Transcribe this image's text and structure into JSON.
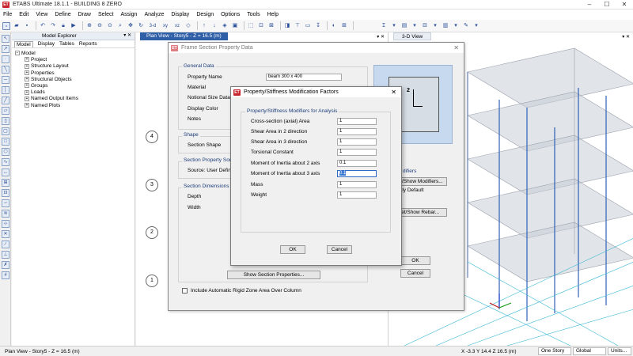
{
  "app": {
    "title": "ETABS Ultimate 18.1.1 - BUILDING 8 ZERO",
    "icon_label": "ET"
  },
  "menu": [
    "File",
    "Edit",
    "View",
    "Define",
    "Draw",
    "Select",
    "Assign",
    "Analyze",
    "Display",
    "Design",
    "Options",
    "Tools",
    "Help"
  ],
  "toolbar": {
    "zoom_label": "3-d",
    "plan_label": "xy",
    "elev_label": "xz",
    "icons": [
      "new-icon",
      "open-icon",
      "save-icon",
      "undo-icon",
      "redo-icon",
      "lock-icon",
      "run-icon",
      "zoom-in-icon",
      "zoom-out-icon",
      "zoom-fit-icon",
      "pan-icon"
    ]
  },
  "explorer": {
    "title": "Model Explorer",
    "tabs": [
      "Model",
      "Display",
      "Tables",
      "Reports"
    ],
    "root": "Model",
    "items": [
      "Project",
      "Structure Layout",
      "Properties",
      "Structural Objects",
      "Groups",
      "Loads",
      "Named Output Items",
      "Named Plots"
    ]
  },
  "plan_view": {
    "tab": "Plan View - Story5 - Z = 16.5 (m)",
    "bubbles": [
      "4",
      "3",
      "2",
      "1"
    ]
  },
  "view3d": {
    "tab": "3-D View"
  },
  "frame_dialog": {
    "title": "Frame Section Property Data",
    "general_data": "General Data",
    "property_name_label": "Property Name",
    "property_name_value": "beam 300 x 400",
    "material_label": "Material",
    "notional_label": "Notional Size Data",
    "display_color_label": "Display Color",
    "notes_label": "Notes",
    "shape_group": "Shape",
    "section_shape_label": "Section Shape",
    "source_group": "Section Property Source",
    "source_label": "Source:  User Defined",
    "dimensions_group": "Section Dimensions",
    "depth_label": "Depth",
    "width_label": "Width",
    "preview_axis": "2",
    "modifiers_btn": "Set/Show Modifiers...",
    "modifiers_group_partial": "difiers",
    "modifiers_status": "rrently Default",
    "rebar_btn": "Set/Show Rebar...",
    "show_props_btn": "Show Section Properties...",
    "rigid_zone_label": "Include Automatic Rigid Zone Area Over Column",
    "ok": "OK",
    "cancel": "Cancel"
  },
  "modifiers_dialog": {
    "title": "Property/Stiffness Modification Factors",
    "group": "Property/Stiffness Modifiers for Analysis",
    "rows": [
      {
        "label": "Cross-section (axial) Area",
        "value": "1"
      },
      {
        "label": "Shear Area in 2 direction",
        "value": "1"
      },
      {
        "label": "Shear Area in 3 direction",
        "value": "1"
      },
      {
        "label": "Torsional Constant",
        "value": "1"
      },
      {
        "label": "Moment of Inertia about 2 axis",
        "value": "0.1"
      },
      {
        "label": "Moment of Inertia about 3 axis",
        "value": "0.1"
      },
      {
        "label": "Mass",
        "value": "1"
      },
      {
        "label": "Weight",
        "value": "1"
      }
    ],
    "ok": "OK",
    "cancel": "Cancel"
  },
  "status": {
    "left": "Plan View - Story5 - Z = 16.5 (m)",
    "coords": "X -3.3  Y 14.4  Z 16.5 (m)",
    "story": "One Story",
    "coord_sys": "Global",
    "units": "Units..."
  }
}
